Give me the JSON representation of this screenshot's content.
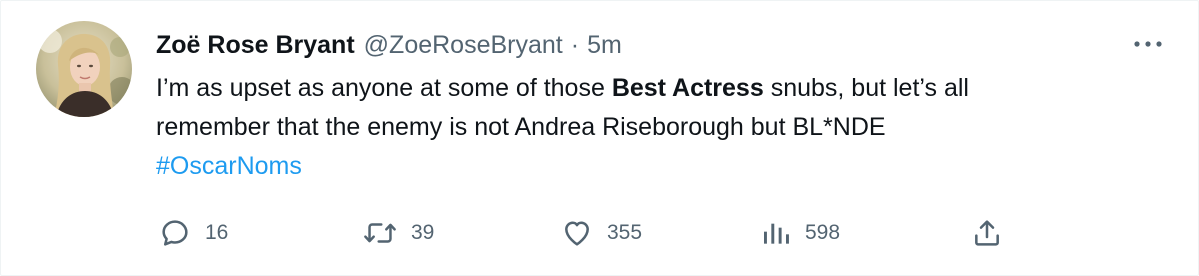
{
  "tweet": {
    "author": {
      "display_name": "Zoë Rose Bryant",
      "handle": "@ZoeRoseBryant",
      "separator": "·",
      "time_ago": "5m"
    },
    "body": {
      "line1_pre": "I’m as upset as anyone at some of those ",
      "line1_bold": "Best Actress",
      "line1_post": " snubs, but let’s all",
      "line2": "remember that the enemy is not Andrea Riseborough but BL*NDE",
      "hashtag": "#OscarNoms"
    },
    "actions": {
      "reply_count": "16",
      "retweet_count": "39",
      "like_count": "355",
      "views_count": "598"
    },
    "icons": {
      "more": "more-horizontal-icon",
      "reply": "reply-bubble-icon",
      "retweet": "retweet-arrows-icon",
      "like": "heart-icon",
      "views": "bar-chart-icon",
      "share": "share-upload-icon"
    },
    "colors": {
      "text_primary": "#0f1419",
      "text_secondary": "#536471",
      "link": "#1d9bf0"
    }
  }
}
